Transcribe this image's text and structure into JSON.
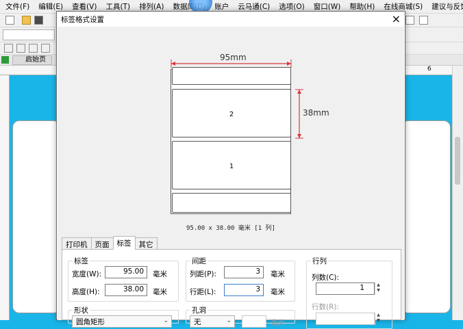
{
  "menubar": {
    "items": [
      "文件(F)",
      "编辑(E)",
      "查看(V)",
      "工具(T)",
      "排列(A)",
      "数据库(D)",
      "账户",
      "云马通(C)",
      "选项(O)",
      "窗口(W)",
      "帮助(H)",
      "在线商城(S)",
      "建议与反馈"
    ]
  },
  "document_tab": {
    "label": "启始页"
  },
  "dialog": {
    "title": "标签格式设置",
    "close_glyph": "×",
    "preview": {
      "width_dim": "95mm",
      "height_dim": "38mm",
      "label_2": "2",
      "label_1": "1",
      "caption": "95.00 x 38.00 毫米 [1 列]"
    },
    "tabs": [
      "打印机",
      "页面",
      "标签",
      "其它"
    ],
    "active_tab": "标签",
    "label_group": {
      "title": "标签",
      "width_label": "宽度(W):",
      "width_value": "95.00",
      "width_unit": "毫米",
      "height_label": "高度(H):",
      "height_value": "38.00",
      "height_unit": "毫米"
    },
    "gap_group": {
      "title": "间距",
      "col_label": "列距(P):",
      "col_value": "3",
      "col_unit": "毫米",
      "row_label": "行距(L):",
      "row_value": "3",
      "row_unit": "毫米"
    },
    "rowcol_group": {
      "title": "行列",
      "cols_label": "列数(C):",
      "cols_value": "1",
      "rows_label": "行数(R):",
      "rows_value": ""
    },
    "shape_group": {
      "title": "形状",
      "value": "圆角矩形"
    },
    "hole_group": {
      "title": "孔洞",
      "value": "无",
      "unit": "毫米"
    }
  },
  "colors": {
    "workspace": "#1ab5e8",
    "dimension_line": "#d9363e",
    "focus": "#3c7fcc"
  }
}
